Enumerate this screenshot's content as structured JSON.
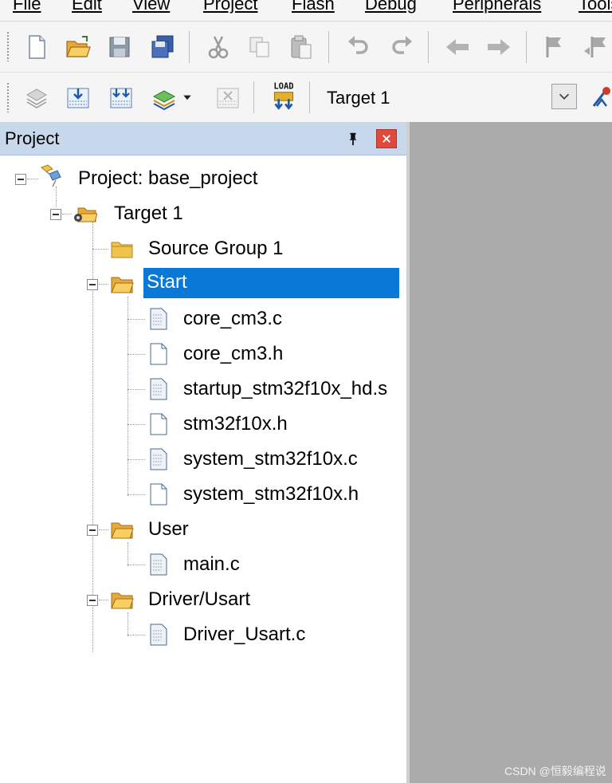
{
  "menubar": {
    "items": [
      "File",
      "Edit",
      "View",
      "Project",
      "Flash",
      "Debug",
      "Peripherals",
      "Tools"
    ]
  },
  "toolbar1": {
    "icons": [
      "new-file-icon",
      "open-folder-icon",
      "save-icon",
      "save-all-icon",
      "cut-icon",
      "copy-icon",
      "paste-icon",
      "undo-icon",
      "redo-icon",
      "navigate-back-icon",
      "navigate-forward-icon",
      "bookmark-icon",
      "bookmark-prev-icon"
    ]
  },
  "toolbar2": {
    "icons": [
      "translate-icon",
      "build-icon",
      "rebuild-icon",
      "batch-build-icon",
      "stop-build-icon",
      "download-icon",
      "options-for-target-icon"
    ],
    "load_icon_text": "LOAD",
    "target": "Target 1"
  },
  "project_panel": {
    "title": "Project",
    "pin_icon": "pin-icon",
    "close_icon": "close-icon",
    "accent": "#0a78d7",
    "tree": {
      "project": "Project: base_project",
      "target": "Target 1",
      "groups": [
        {
          "name": "Source Group 1",
          "files": []
        },
        {
          "name": "Start",
          "selected": true,
          "files": [
            "core_cm3.c",
            "core_cm3.h",
            "startup_stm32f10x_hd.s",
            "stm32f10x.h",
            "system_stm32f10x.c",
            "system_stm32f10x.h"
          ]
        },
        {
          "name": "User",
          "files": [
            "main.c"
          ]
        },
        {
          "name": "Driver/Usart",
          "files": [
            "Driver_Usart.c"
          ]
        }
      ]
    }
  },
  "watermark": "CSDN @恒毅编程说"
}
